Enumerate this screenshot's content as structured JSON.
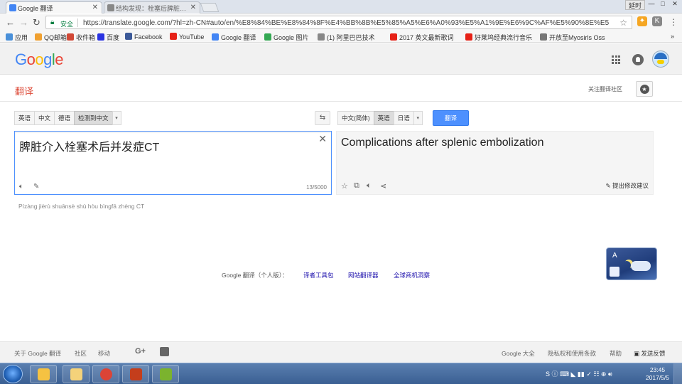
{
  "browser": {
    "tabs": [
      {
        "title": "Google 翻译",
        "active": true
      },
      {
        "title": "结构发现：栓塞后脾脏…",
        "active": false
      }
    ],
    "window_controls": {
      "user_label": "延时",
      "minimize": "—",
      "maximize": "□",
      "close": "✕"
    },
    "address": {
      "security_label": "安全",
      "url": "https://translate.google.com/?hl=zh-CN#auto/en/%E8%84%BE%E8%84%8F%E4%BB%8B%E5%85%A5%E6%A0%93%E5%A1%9E%E6%9C%AF%E5%90%8E%E5%"
    },
    "bookmarks": [
      {
        "label": "应用",
        "color": "#4a90d9"
      },
      {
        "label": "QQ邮箱",
        "color": "#f0a030"
      },
      {
        "label": "收件箱",
        "color": "#d14836"
      },
      {
        "label": "百度",
        "color": "#2932e1"
      },
      {
        "label": "Facebook",
        "color": "#3b5998"
      },
      {
        "label": "YouTube",
        "color": "#e62117"
      },
      {
        "label": "Google 翻译",
        "color": "#4285f4"
      },
      {
        "label": "Google 图片",
        "color": "#34a853"
      },
      {
        "label": "(1) 阿里巴巴技术",
        "color": "#888888"
      },
      {
        "label": "2017 英文最新歌词",
        "color": "#e62117"
      },
      {
        "label": "好莱坞经典流行音乐",
        "color": "#e62117"
      },
      {
        "label": "开放至Myosirls Oss",
        "color": "#777777"
      }
    ],
    "overflow": "»"
  },
  "google": {
    "logo": {
      "letters": [
        "G",
        "o",
        "o",
        "g",
        "l",
        "e"
      ],
      "colors": [
        "#4285f4",
        "#ea4335",
        "#fbbc05",
        "#4285f4",
        "#34a853",
        "#ea4335"
      ]
    },
    "page_title": "翻译",
    "community_label": "关注翻译社区"
  },
  "source": {
    "langs": [
      "英语",
      "中文",
      "德语",
      "检测到中文"
    ],
    "selected_index": 3,
    "dropdown": "▾",
    "text": "脾脏介入栓塞术后并发症CT",
    "char_count": "13/5000",
    "pinyin": "Pízàng jièrù shuānsè shù hòu bìngfā zhèng CT"
  },
  "target": {
    "langs": [
      "中文(简体)",
      "英语",
      "日语"
    ],
    "selected_index": 1,
    "dropdown": "▾",
    "translate_button": "翻译",
    "text": "Complications after splenic embolization",
    "suggest_edit": "提出修改建议"
  },
  "footer_links": [
    {
      "label": "Google 翻译（个人版）：",
      "link": false
    },
    {
      "label": "译者工具包",
      "link": true
    },
    {
      "label": "网站翻译器",
      "link": true
    },
    {
      "label": "全球商机洞察",
      "link": true
    }
  ],
  "footer": {
    "left": [
      "关于 Google 翻译",
      "社区",
      "移动"
    ],
    "right": [
      "Google 大全",
      "隐私权和使用条款",
      "帮助",
      "发送反馈"
    ]
  },
  "taskbar": {
    "time": "23:45",
    "date": "2017/5/5",
    "apps": [
      {
        "name": "explorer",
        "color": "#f5c242"
      },
      {
        "name": "windows-explorer",
        "color": "#f4d27a"
      },
      {
        "name": "chrome",
        "color": "#db4437"
      },
      {
        "name": "powerpoint",
        "color": "#c43e1c"
      },
      {
        "name": "wechat",
        "color": "#7bb32e"
      }
    ]
  }
}
